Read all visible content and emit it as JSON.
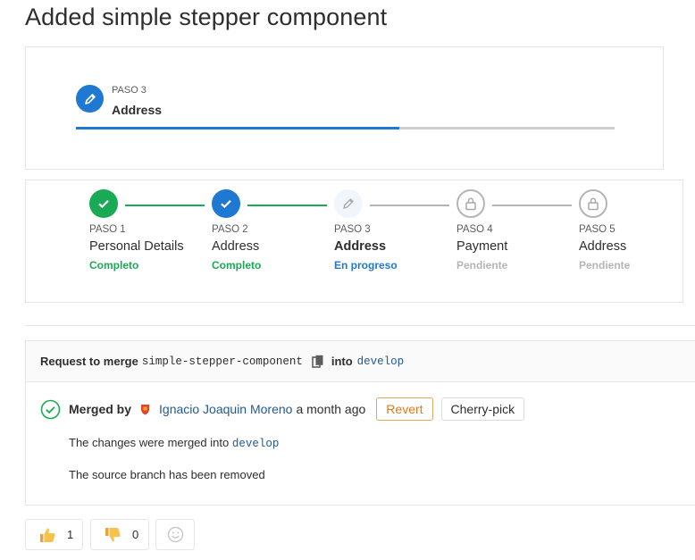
{
  "page": {
    "title": "Added simple stepper component"
  },
  "compact_stepper": {
    "step": "PASO 3",
    "label": "Address",
    "progress_pct": 60
  },
  "stepper": {
    "steps": [
      {
        "num": "PASO 1",
        "label": "Personal Details",
        "status": "Completo",
        "state": "done-green"
      },
      {
        "num": "PASO 2",
        "label": "Address",
        "status": "Completo",
        "state": "done-blue"
      },
      {
        "num": "PASO 3",
        "label": "Address",
        "status": "En progreso",
        "state": "current"
      },
      {
        "num": "PASO 4",
        "label": "Payment",
        "status": "Pendiente",
        "state": "pending"
      },
      {
        "num": "PASO 5",
        "label": "Address",
        "status": "Pendiente",
        "state": "pending"
      }
    ],
    "colors": {
      "complete": "#1aaa55",
      "in_progress": "#1f78d1",
      "pending": "#b5b5b5"
    }
  },
  "merge": {
    "prefix": "Request to merge",
    "source_branch": "simple-stepper-component",
    "into": "into",
    "target_branch": "develop",
    "merged_by": "Merged by",
    "author": "Ignacio Joaquin Moreno",
    "ago": "a month ago",
    "revert_label": "Revert",
    "cherry_pick_label": "Cherry-pick",
    "merged_text": "The changes were merged into",
    "merged_branch": "develop",
    "removed_text": "The source branch has been removed"
  },
  "awards": {
    "thumbs_up": "1",
    "thumbs_down": "0"
  }
}
